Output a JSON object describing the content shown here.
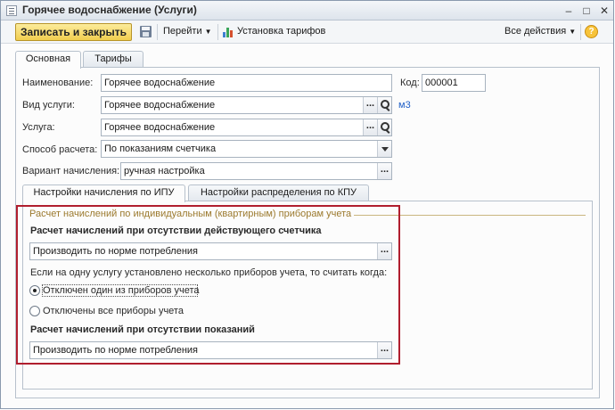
{
  "window": {
    "title": "Горячее водоснабжение (Услуги)",
    "min": "–",
    "max": "□",
    "close": "✕"
  },
  "toolbar": {
    "save_close": "Записать и закрыть",
    "goto": "Перейти",
    "tariffs": "Установка тарифов",
    "all_actions": "Все действия",
    "help": "?"
  },
  "tabs": [
    "Основная",
    "Тарифы"
  ],
  "form": {
    "name_label": "Наименование:",
    "name_value": "Горячее водоснабжение",
    "code_label": "Код:",
    "code_value": "000001",
    "service_type_label": "Вид услуги:",
    "service_type_value": "Горячее водоснабжение",
    "unit": "м3",
    "service_label": "Услуга:",
    "service_value": "Горячее водоснабжение",
    "calc_method_label": "Способ расчета:",
    "calc_method_value": "По показаниям счетчика",
    "accrual_variant_label": "Вариант начисления:",
    "accrual_variant_value": "ручная настройка"
  },
  "inner_tabs": [
    "Настройки начисления по ИПУ",
    "Настройки распределения по КПУ"
  ],
  "ipu": {
    "group_title": "Расчет начислений по индивидуальным (квартирным) приборам учета",
    "no_meter_title": "Расчет начислений при отсутствии действующего счетчика",
    "no_meter_value": "Производить по норме потребления",
    "multi_meter_text": "Если на одну услугу установлено несколько приборов учета, то считать когда:",
    "radio_options": [
      "Отключен один из приборов учета",
      "Отключены все приборы учета"
    ],
    "selected_option": "Отключен один из приборов учета",
    "no_readings_title": "Расчет начислений при отсутствии показаний",
    "no_readings_value": "Производить по норме потребления"
  },
  "colors": {
    "highlight": "#b01e2e",
    "primary_button": "#f1cd4e",
    "link": "#1f5fc7",
    "group_title": "#9c7a2e"
  },
  "icons": [
    "form-icon",
    "save-icon",
    "chart-icon",
    "help-icon",
    "search-icon",
    "ellipsis-icon",
    "dropdown-icon"
  ]
}
